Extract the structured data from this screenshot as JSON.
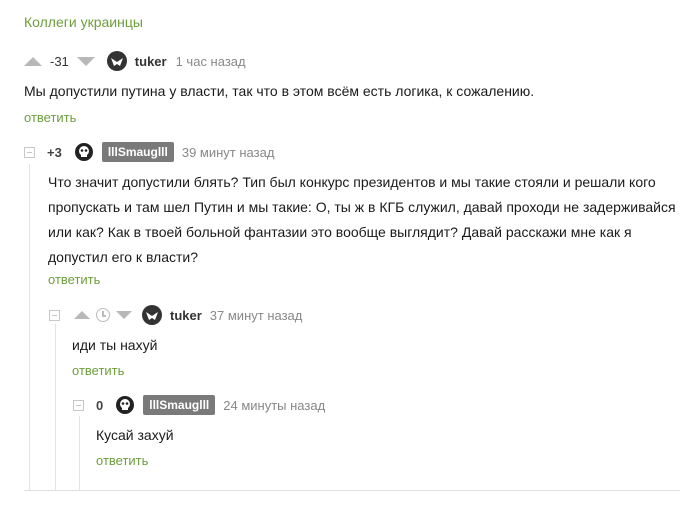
{
  "header": {
    "link": "Коллеги украинцы"
  },
  "comments": [
    {
      "rating": "-31",
      "author": "tuker",
      "time": "1 час назад",
      "text": "Мы допустили путина у власти, так что в этом всём есть логика, к сожалению.",
      "reply": "ответить"
    },
    {
      "rating": "+3",
      "author": "lllSmauglll",
      "time": "39 минут назад",
      "text": "Что значит допустили блять? Тип был конкурс президентов и мы такие стояли и решали кого пропускать и там шел Путин и мы такие: О, ты ж в КГБ служил, давай проходи не задерживайся или как? Как в твоей больной фантазии это вообще выглядит? Давай расскажи мне как я допустил его к власти?",
      "reply": "ответить"
    },
    {
      "author": "tuker",
      "time": "37 минут назад",
      "text": "иди ты нахуй",
      "reply": "ответить"
    },
    {
      "rating": "0",
      "author": "lllSmauglll",
      "time": "24 минуты назад",
      "text": "Кусай захуй",
      "reply": "ответить"
    }
  ],
  "icons": {
    "upvote": "arrow-up-icon",
    "downvote": "arrow-down-icon",
    "collapse": "collapse-icon",
    "clock": "clock-icon"
  },
  "colors": {
    "accent": "#6d9e3c",
    "badge": "#7a7a7a",
    "muted": "#888888",
    "arrow": "#b8b8b8"
  }
}
